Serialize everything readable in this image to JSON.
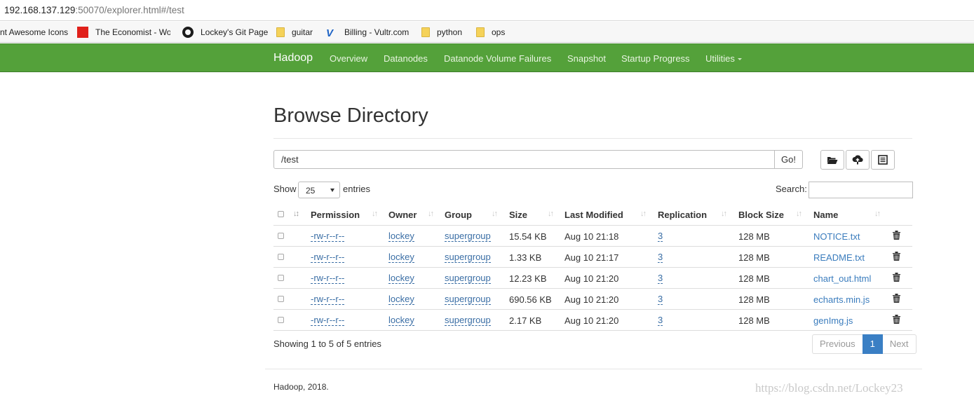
{
  "address_bar": {
    "host": "192.168.137.129",
    "rest": ":50070/explorer.html#/test"
  },
  "bookmarks": [
    {
      "label": "nt Awesome Icons",
      "icon": "none"
    },
    {
      "label": "The Economist - Wo",
      "icon": "red-square-icon"
    },
    {
      "label": "Lockey's Git Page",
      "icon": "github-icon"
    },
    {
      "label": "guitar",
      "icon": "folder-icon"
    },
    {
      "label": "Billing - Vultr.com",
      "icon": "vultr-icon"
    },
    {
      "label": "python",
      "icon": "folder-icon"
    },
    {
      "label": "ops",
      "icon": "folder-icon"
    }
  ],
  "navbar": {
    "brand": "Hadoop",
    "links": [
      "Overview",
      "Datanodes",
      "Datanode Volume Failures",
      "Snapshot",
      "Startup Progress",
      "Utilities"
    ],
    "color": "#54a13a"
  },
  "page": {
    "title": "Browse Directory",
    "path_value": "/test",
    "go_label": "Go!",
    "toolbar_icons": [
      "folder-open-icon",
      "upload-cloud-icon",
      "list-icon"
    ]
  },
  "table_controls": {
    "show_label": "Show",
    "entries_value": "25",
    "entries_label": "entries",
    "search_label": "Search:",
    "search_value": ""
  },
  "table": {
    "columns": [
      "Permission",
      "Owner",
      "Group",
      "Size",
      "Last Modified",
      "Replication",
      "Block Size",
      "Name"
    ],
    "rows": [
      {
        "permission": "-rw-r--r--",
        "owner": "lockey",
        "group": "supergroup",
        "size": "15.54 KB",
        "modified": "Aug 10 21:18",
        "replication": "3",
        "block_size": "128 MB",
        "name": "NOTICE.txt"
      },
      {
        "permission": "-rw-r--r--",
        "owner": "lockey",
        "group": "supergroup",
        "size": "1.33 KB",
        "modified": "Aug 10 21:17",
        "replication": "3",
        "block_size": "128 MB",
        "name": "README.txt"
      },
      {
        "permission": "-rw-r--r--",
        "owner": "lockey",
        "group": "supergroup",
        "size": "12.23 KB",
        "modified": "Aug 10 21:20",
        "replication": "3",
        "block_size": "128 MB",
        "name": "chart_out.html"
      },
      {
        "permission": "-rw-r--r--",
        "owner": "lockey",
        "group": "supergroup",
        "size": "690.56 KB",
        "modified": "Aug 10 21:20",
        "replication": "3",
        "block_size": "128 MB",
        "name": "echarts.min.js"
      },
      {
        "permission": "-rw-r--r--",
        "owner": "lockey",
        "group": "supergroup",
        "size": "2.17 KB",
        "modified": "Aug 10 21:20",
        "replication": "3",
        "block_size": "128 MB",
        "name": "genImg.js"
      }
    ]
  },
  "pagination": {
    "showing": "Showing 1 to 5 of 5 entries",
    "prev": "Previous",
    "current": "1",
    "next": "Next"
  },
  "footer": {
    "text": "Hadoop, 2018."
  },
  "watermark": "https://blog.csdn.net/Lockey23"
}
